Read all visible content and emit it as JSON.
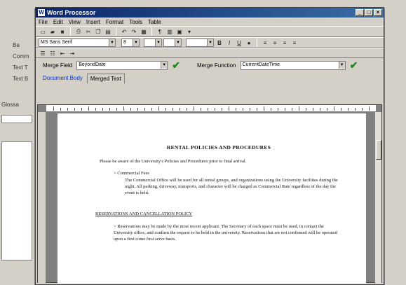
{
  "window": {
    "title": "Word Processor",
    "controls": [
      "_",
      "□",
      "×"
    ]
  },
  "menu": [
    "File",
    "Edit",
    "View",
    "Insert",
    "Format",
    "Tools",
    "Table"
  ],
  "formatting": {
    "font_name": "MS Sans Serif",
    "font_size": "8"
  },
  "merge": {
    "field_label": "Merge Field",
    "field_value": "BeyondDate",
    "function_label": "Merge Function",
    "function_value": "CurrentDateTime"
  },
  "tabs": [
    {
      "label": "Document Body",
      "active": true
    },
    {
      "label": "Merged Text",
      "active": false
    }
  ],
  "document": {
    "title": "RENTAL POLICIES AND PROCEDURES",
    "intro": "Please be aware of the University's Policies and Procedures prior to final arrival.",
    "bullet1": "Commercial Fees",
    "bullet1_text": "The Commercial Office will be used for all rental groups, and organizations using the University facilities during the night. All parking, driveway, transports, and character will be charged as Commercial Rate regardless of the day the event is held.",
    "heading": "RESERVATIONS AND CANCELLATION POLICY",
    "bullet2_text": "Reservations may be made by the most recent applicant. The Secretary of each space must be used, in contact the University office, and confirm the request to be held in the university. Reservations that are not confirmed will be operated upon a first come first serve basis."
  },
  "left_panel": {
    "stubs": [
      "Ba",
      "Comm",
      "Text T",
      "Text B",
      "Glossa"
    ]
  }
}
